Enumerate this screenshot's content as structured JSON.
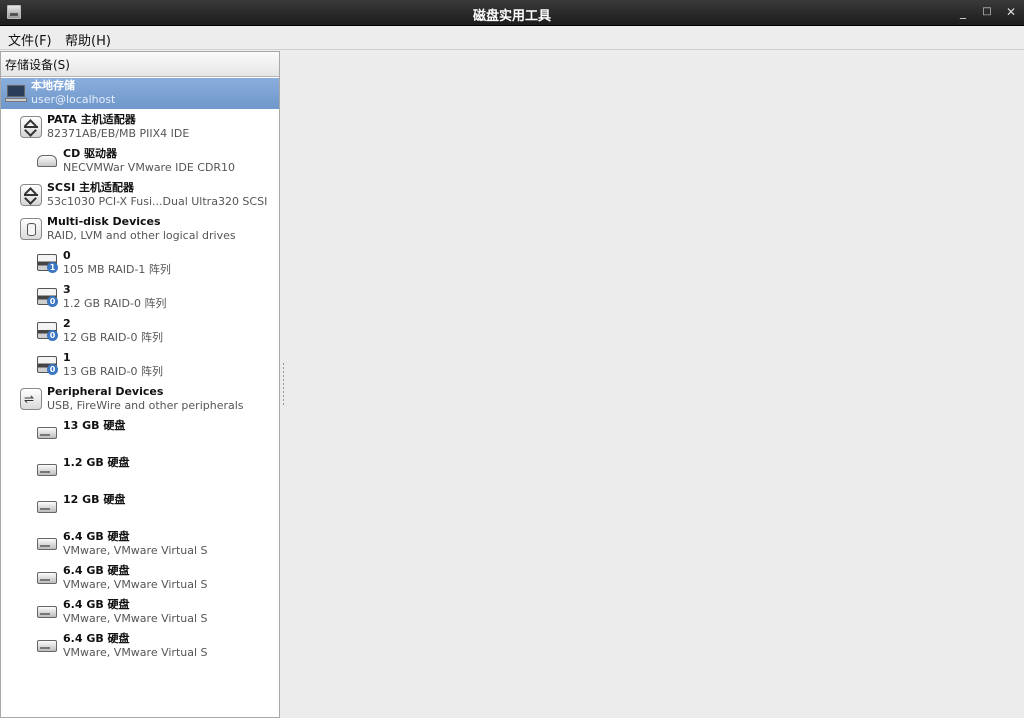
{
  "window": {
    "title": "磁盘实用工具",
    "controls": {
      "minimize": "_",
      "maximize": "□",
      "close": "✕"
    }
  },
  "menubar": {
    "file": "文件(F)",
    "help": "帮助(H)"
  },
  "sidebar": {
    "header": "存储设备(S)",
    "items": [
      {
        "icon": "laptop-icon",
        "title": "本地存储",
        "subtitle": "user@localhost",
        "selected": true
      },
      {
        "icon": "controller-icon",
        "title": "PATA 主机适配器",
        "subtitle": "82371AB/EB/MB PIIX4 IDE"
      },
      {
        "icon": "cdrom-icon",
        "title": "CD 驱动器",
        "subtitle": "NECVMWar VMware IDE CDR10"
      },
      {
        "icon": "controller-icon",
        "title": "SCSI 主机适配器",
        "subtitle": "53c1030 PCI-X Fusi...Dual Ultra320 SCSI"
      },
      {
        "icon": "multidisk-icon",
        "title": "Multi-disk Devices",
        "subtitle": "RAID, LVM and other logical drives"
      },
      {
        "icon": "raid-icon",
        "badge": "1",
        "title": "0",
        "subtitle": "105 MB RAID-1 阵列"
      },
      {
        "icon": "raid-icon",
        "badge": "0",
        "title": "3",
        "subtitle": "1.2 GB RAID-0 阵列"
      },
      {
        "icon": "raid-icon",
        "badge": "0",
        "title": "2",
        "subtitle": "12 GB RAID-0 阵列"
      },
      {
        "icon": "raid-icon",
        "badge": "0",
        "title": "1",
        "subtitle": "13 GB RAID-0 阵列"
      },
      {
        "icon": "usb-icon",
        "title": "Peripheral Devices",
        "subtitle": "USB, FireWire and other peripherals"
      },
      {
        "icon": "hard-drive-icon",
        "title": "13 GB 硬盘",
        "subtitle": ""
      },
      {
        "icon": "hard-drive-icon",
        "title": "1.2 GB 硬盘",
        "subtitle": ""
      },
      {
        "icon": "hard-drive-icon",
        "title": "12 GB 硬盘",
        "subtitle": ""
      },
      {
        "icon": "hard-drive-icon",
        "title": "6.4 GB 硬盘",
        "subtitle": "VMware, VMware Virtual S"
      },
      {
        "icon": "hard-drive-icon",
        "title": "6.4 GB 硬盘",
        "subtitle": "VMware, VMware Virtual S"
      },
      {
        "icon": "hard-drive-icon",
        "title": "6.4 GB 硬盘",
        "subtitle": "VMware, VMware Virtual S"
      },
      {
        "icon": "hard-drive-icon",
        "title": "6.4 GB 硬盘",
        "subtitle": "VMware, VMware Virtual S"
      }
    ]
  },
  "colors": {
    "selection": "#7aa0d2",
    "titlebar": "#2a2a2a",
    "raid_badge": "#3b76c2"
  }
}
